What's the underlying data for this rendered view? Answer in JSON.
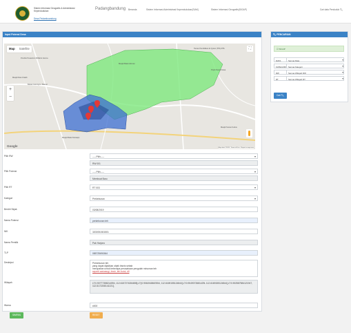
{
  "header": {
    "site_name": "Sistem Informasi Geografis & Administrasi Kependudukan",
    "desa_link": "Desa Pedamboandung",
    "brand": "Padangbandung",
    "nav": [
      "Beranda",
      "Sistem Informasi Administrasi Kependudukan(SIAK)",
      "Sistem Informasi Geografis(SIGAP)"
    ],
    "right_link": "Cari data Penduduk",
    "search_icon": "search-icon"
  },
  "main_panel": {
    "title": "Input Potensi Desa"
  },
  "map": {
    "tab_map": "Map",
    "tab_satellite": "Satellite",
    "zoom_in": "+",
    "zoom_out": "−",
    "google": "Google",
    "attribution": "Map data ©2019 · Terms of Use · Report a map error",
    "labels": [
      "Taman Pendidikan Al Quran (TPA) PPL",
      "Pondok Pesantren Miftahul Hunna",
      "Pojok Dewa Dawa",
      "Bebek Goreng H. Slamet",
      "Masjid Sunan Kudus",
      "Masjid Baiturrahman",
      "Masjid Darul Falah",
      "Masjid Baitul Muttaqin"
    ],
    "colors": {
      "green_poly": "#7ee87e",
      "blue_poly": "#3e6fd1",
      "marker": "#e53935"
    }
  },
  "form": {
    "pilih_rw_label": "Pilih RW",
    "pilih_rw_value": "-----Pilih-----",
    "rw_readonly": "RW 001",
    "pilih_potensi_label": "Pilih Potensi",
    "pilih_potensi_value": "-----Pilih-----",
    "potensi_readonly": "Membuat Baru",
    "pilih_rt_label": "Pilih RT",
    "pilih_rt_value": "RT 003",
    "kategori_label": "Kategori",
    "kategori_value": "Perkebunan",
    "berdiri_label": "Berdiri Sejak",
    "berdiri_value": "03/08/2019",
    "nama_potensi_label": "Nama Potensi",
    "nama_potensi_value": "perkebunan teh",
    "nik_label": "NIK",
    "nik_value": "3202051501501",
    "nama_pemilik_label": "Nama Pemilik",
    "nama_pemilik_value": "Pak Harjono",
    "tlp_label": "TLP",
    "tlp_value": "085725691564",
    "deskripsi_label": "Deskripsi",
    "deskripsi_lines": [
      "Perkebunan teh",
      "yang dapat dijadikan objek bisnis sebab",
      "merupakan untuk beberapa perusahaan pengolah minuman teh"
    ],
    "deskripsi_underlined": "seperti sariwangi, fresh, teh botol, dll",
    "wilayah_label": "Wilayah",
    "wilayah_value": "LT:0.90777 PT:0,1-10 77 99 (-0,3 (0 4B 4,8s0 1 1 (2) (0 1 1 0 (11,0 4 0 (00)",
    "wilayah_display": "LT:0,90777358214594, 112.6157274284655],LT:[0.9061948667654, 112.6169155124844],LT:0.9049072681429L 112.6169155124844],LT:0.902587584121947, 112.6172208141221],",
    "wama_label": "Warna",
    "wama_value": "#000",
    "simpan": "SIMPAN",
    "reset": "RESET"
  },
  "side_panel": {
    "title": "PENCARIAN",
    "sigap": "SIGAP",
    "rows": [
      {
        "key": "DATA",
        "value": "Semua Data"
      },
      {
        "key": "KATEGORI",
        "value": "Semua Kategori"
      },
      {
        "key": "RW",
        "value": "Semua Wilayah RW"
      },
      {
        "key": "RT",
        "value": "Semua Wilayah RT"
      }
    ],
    "cari": "Cari"
  }
}
